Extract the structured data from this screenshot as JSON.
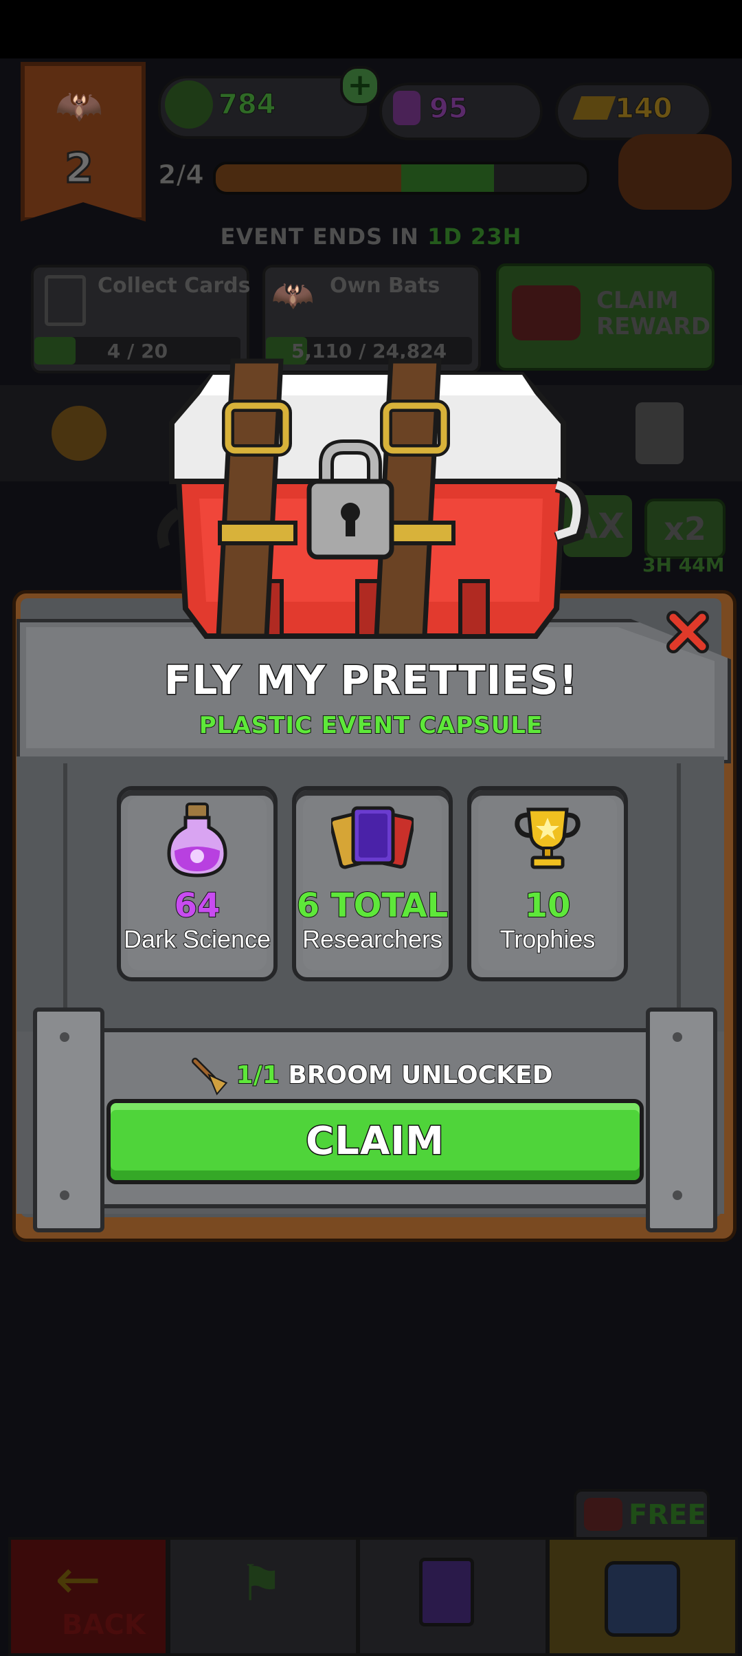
{
  "hud": {
    "rank": "2",
    "currency_green": "784",
    "currency_potion": "95",
    "currency_gold": "140",
    "progress_label": "2/4",
    "progress_fraction": 0.5,
    "colors": {
      "green": "#2f7c2a",
      "potion": "#6b2c7a",
      "gold": "#8a6a10"
    }
  },
  "event": {
    "ends_prefix": "EVENT ENDS IN",
    "ends_days": "1D",
    "ends_hours": "23H",
    "tasks": [
      {
        "title": "Collect Cards",
        "progress": "4 / 20",
        "fraction": 0.2
      },
      {
        "title": "Own Bats",
        "progress": "5,110 / 24,824",
        "fraction": 0.2
      }
    ],
    "claim_reward_line1": "CLAIM",
    "claim_reward_line2": "REWARD"
  },
  "side": {
    "max_label": "AX",
    "boost_label": "x2",
    "boost_time": "3H 44M"
  },
  "modal": {
    "title": "FLY MY PRETTIES!",
    "subtitle": "PLASTIC EVENT CAPSULE",
    "rewards": [
      {
        "value": "64",
        "label": "Dark Science",
        "icon": "potion-icon",
        "color": "#c84cf0"
      },
      {
        "value": "6 TOTAL",
        "label": "Researchers",
        "icon": "cards-icon",
        "color": "#5ee83a"
      },
      {
        "value": "10",
        "label": "Trophies",
        "icon": "trophy-icon",
        "color": "#5ee83a"
      }
    ],
    "unlock_count": "1/1",
    "unlock_text": "BROOM UNLOCKED",
    "claim_label": "CLAIM",
    "close_icon": "close-icon"
  },
  "bottom": {
    "free_label": "FREE",
    "back_label": "BACK"
  },
  "colors": {
    "accent_green": "#5ee83a",
    "claim_button": "#4fd43a",
    "frame_wood": "#7a4a21",
    "close_red": "#e03a2a"
  }
}
